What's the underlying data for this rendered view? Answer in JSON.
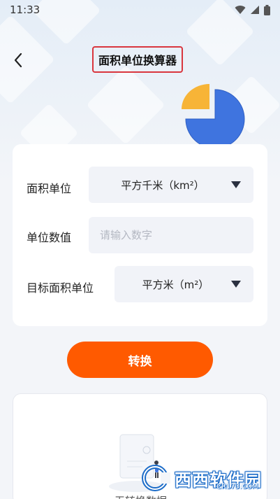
{
  "status_bar": {
    "time": "11:33"
  },
  "nav": {
    "title": "面积单位换算器"
  },
  "form": {
    "source_unit_label": "面积单位",
    "source_unit_value": "平方千米（km²）",
    "value_label": "单位数值",
    "value_placeholder": "请输入数字",
    "value_current": "",
    "target_unit_label": "目标面积单位",
    "target_unit_value": "平方米（m²）"
  },
  "convert_button": {
    "label": "转换"
  },
  "result": {
    "empty_text": "无转换数据"
  },
  "watermark": {
    "main": "西西软件园",
    "sub": "CR173.COM"
  },
  "colors": {
    "accent": "#ff5a00",
    "title_highlight": "#d9363e",
    "pie_blue": "#3f74df",
    "pie_yellow": "#f7b437"
  }
}
